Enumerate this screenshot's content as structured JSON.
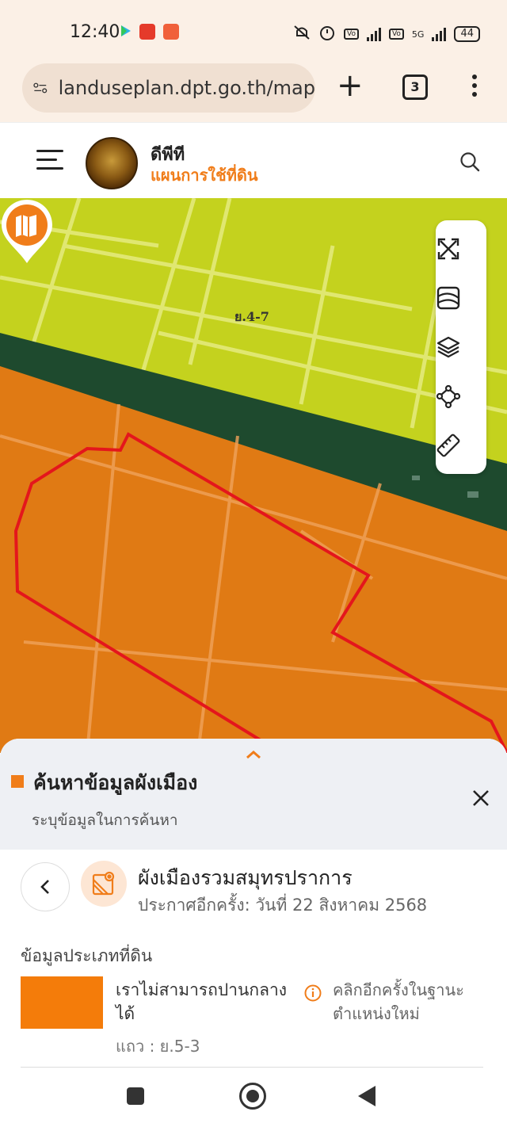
{
  "status_bar": {
    "time": "12:40",
    "network": "5G",
    "battery": "44",
    "icons": [
      "play-store-icon",
      "app-notification-icon",
      "shopee-icon",
      "mute-icon",
      "alarm-icon",
      "volte-icon",
      "signal-icon",
      "volte-icon-2",
      "signal-5g-icon",
      "battery-icon"
    ]
  },
  "browser": {
    "url": "landuseplan.dpt.go.th/map",
    "tab_count": "3"
  },
  "header": {
    "brand_title": "ดีพีที",
    "brand_subtitle": "แผนการใช้ที่ดิน"
  },
  "map": {
    "zone_label": "ย.4-7",
    "tools": [
      "fullscreen-icon",
      "basemap-icon",
      "layers-icon",
      "draw-icon",
      "measure-icon"
    ],
    "colors": {
      "yellow_zone": "#c8d41e",
      "orange_zone": "#e07a14",
      "boundary": "#e4161c"
    }
  },
  "panel": {
    "title": "ค้นหาข้อมูลผังเมือง",
    "subtitle": "ระบุข้อมูลในการค้นหา",
    "plan_name": "ผังเมืองรวมสมุทรปราการ",
    "plan_date": "ประกาศอีกครั้ง: วันที่ 22 สิงหาคม 2568",
    "section_title": "ข้อมูลประเภทที่ดิน",
    "landuse_name": "เราไม่สามารถปานกลางได้",
    "click_hint": "คลิกอีกครั้งในฐานะตำแหน่งใหม่",
    "row_label": "แถว : ย.5-3",
    "swatch_color": "#f47c0a"
  }
}
